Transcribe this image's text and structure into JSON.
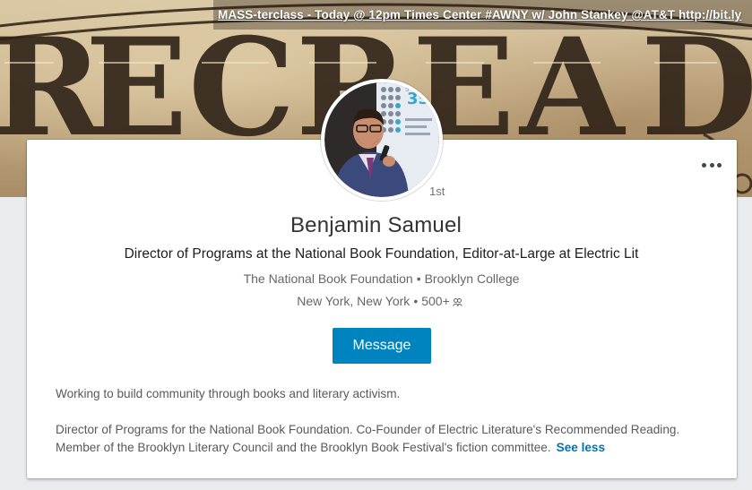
{
  "banner": {
    "ticker_text": "MASS-terclass - Today @ 12pm Times Center #AWNY w/ John Stankey @AT&T http://bit.ly"
  },
  "profile": {
    "degree": "1st",
    "name": "Benjamin Samuel",
    "headline": "Director of Programs at the National Book Foundation, Editor-at-Large at Electric Lit",
    "organization": "The National Book Foundation",
    "school": "Brooklyn College",
    "location": "New York, New York",
    "connections": "500+"
  },
  "actions": {
    "message_label": "Message"
  },
  "summary": {
    "paragraph1": "Working to build community through books and literary activism.",
    "paragraph2": "Director of Programs for the National Book Foundation. Co-Founder of Electric Literature's Recommended Reading. Member of the Brooklyn Literary Council and the Brooklyn Book Festival's fiction committee.",
    "see_less_label": "See less"
  },
  "colors": {
    "primary_button": "#0084bf",
    "link": "#0073b1"
  }
}
